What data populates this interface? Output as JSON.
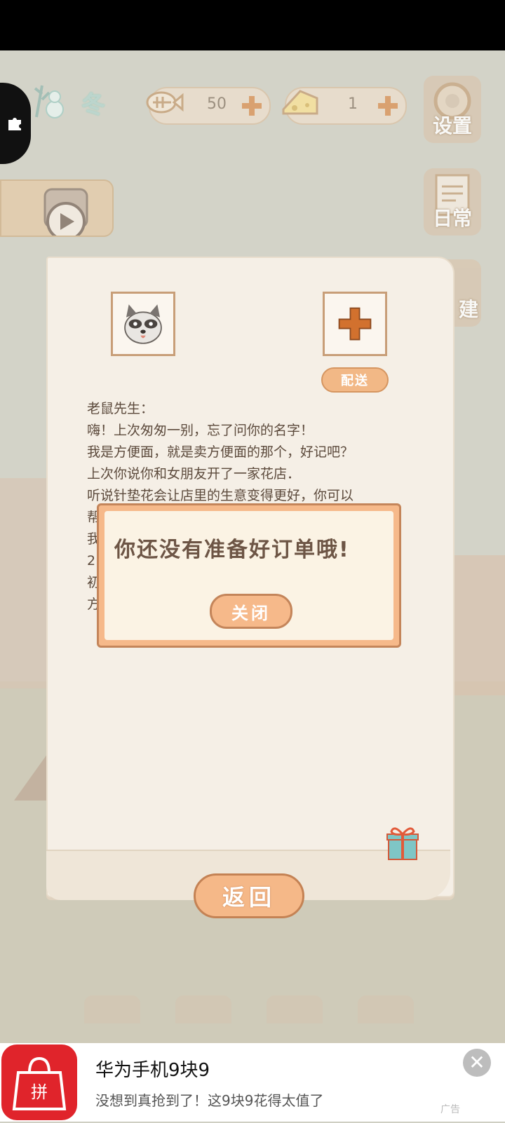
{
  "season": {
    "label": "冬"
  },
  "resources": {
    "fish": "50",
    "cheese": "1"
  },
  "side_buttons": {
    "settings": "设置",
    "daily": "日常",
    "build": "建"
  },
  "letter": {
    "deliver_label": "配送",
    "lines": [
      "老鼠先生：",
      "嗨！上次匆匆一别，忘了问你的名字！",
      "我是方便面，就是卖方便面的那个，好记吧？",
      "上次你说你和女朋友开了一家花店．",
      "听说针垫花会让店里的生意变得更好，你可以",
      "帮",
      "我",
      "2",
      "初",
      "方"
    ]
  },
  "dialog": {
    "message": "你还没有准备好订单哦!",
    "close_label": "关闭"
  },
  "back_label": "返回",
  "ad": {
    "title": "华为手机9块9",
    "subtitle": "没想到真抢到了！这9块9花得太值了",
    "ad_label": "广告",
    "close_glyph": "✕",
    "logo_glyph": "拼"
  }
}
